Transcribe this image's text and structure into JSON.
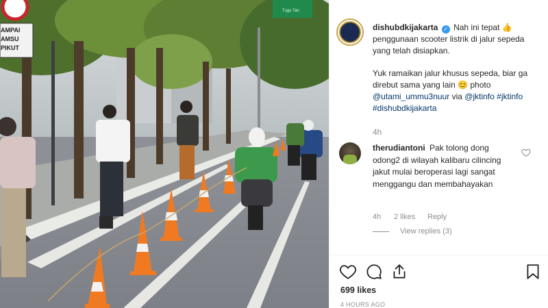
{
  "post": {
    "username": "dishubdkijakarta",
    "verified": true,
    "caption_line1": "Nah ini tepat 👍 penggunaan scooter listrik di jalur sepeda yang telah disiapkan.",
    "caption_line2": "Yuk ramaikan jalur khusus sepeda, biar ga direbut sama yang lain 😊",
    "caption_credit_prefix": "photo ",
    "credit_handle": "@utami_ummu3nuur",
    "credit_via": " via",
    "tag_1": "@jktinfo",
    "tag_2": "#jktinfo",
    "tag_3": "#dishubdkijakarta",
    "time_ago": "4h"
  },
  "comment": {
    "username": "therudiantoni",
    "text": "Pak tolong dong odong2 di wilayah kalibaru cilincing jakut mulai beroperasi lagi sangat menggangu dan membahayakan",
    "time_ago": "4h",
    "likes": "2 likes",
    "reply_label": "Reply",
    "view_replies": "View replies (3)"
  },
  "photo": {
    "sign_lines": [
      "AMPAI",
      "AMSU",
      "PIKUT"
    ],
    "green_sign": "Tugu Tan"
  },
  "footer": {
    "likes_count": "699 likes",
    "posted_time": "4 hours ago"
  },
  "icons": {
    "like": "heart-icon",
    "comment": "comment-icon",
    "share": "share-icon",
    "save": "bookmark-icon"
  },
  "colors": {
    "link": "#003569",
    "muted": "#8e8e8e",
    "verified": "#3897f0",
    "cone_orange": "#f07a22"
  }
}
